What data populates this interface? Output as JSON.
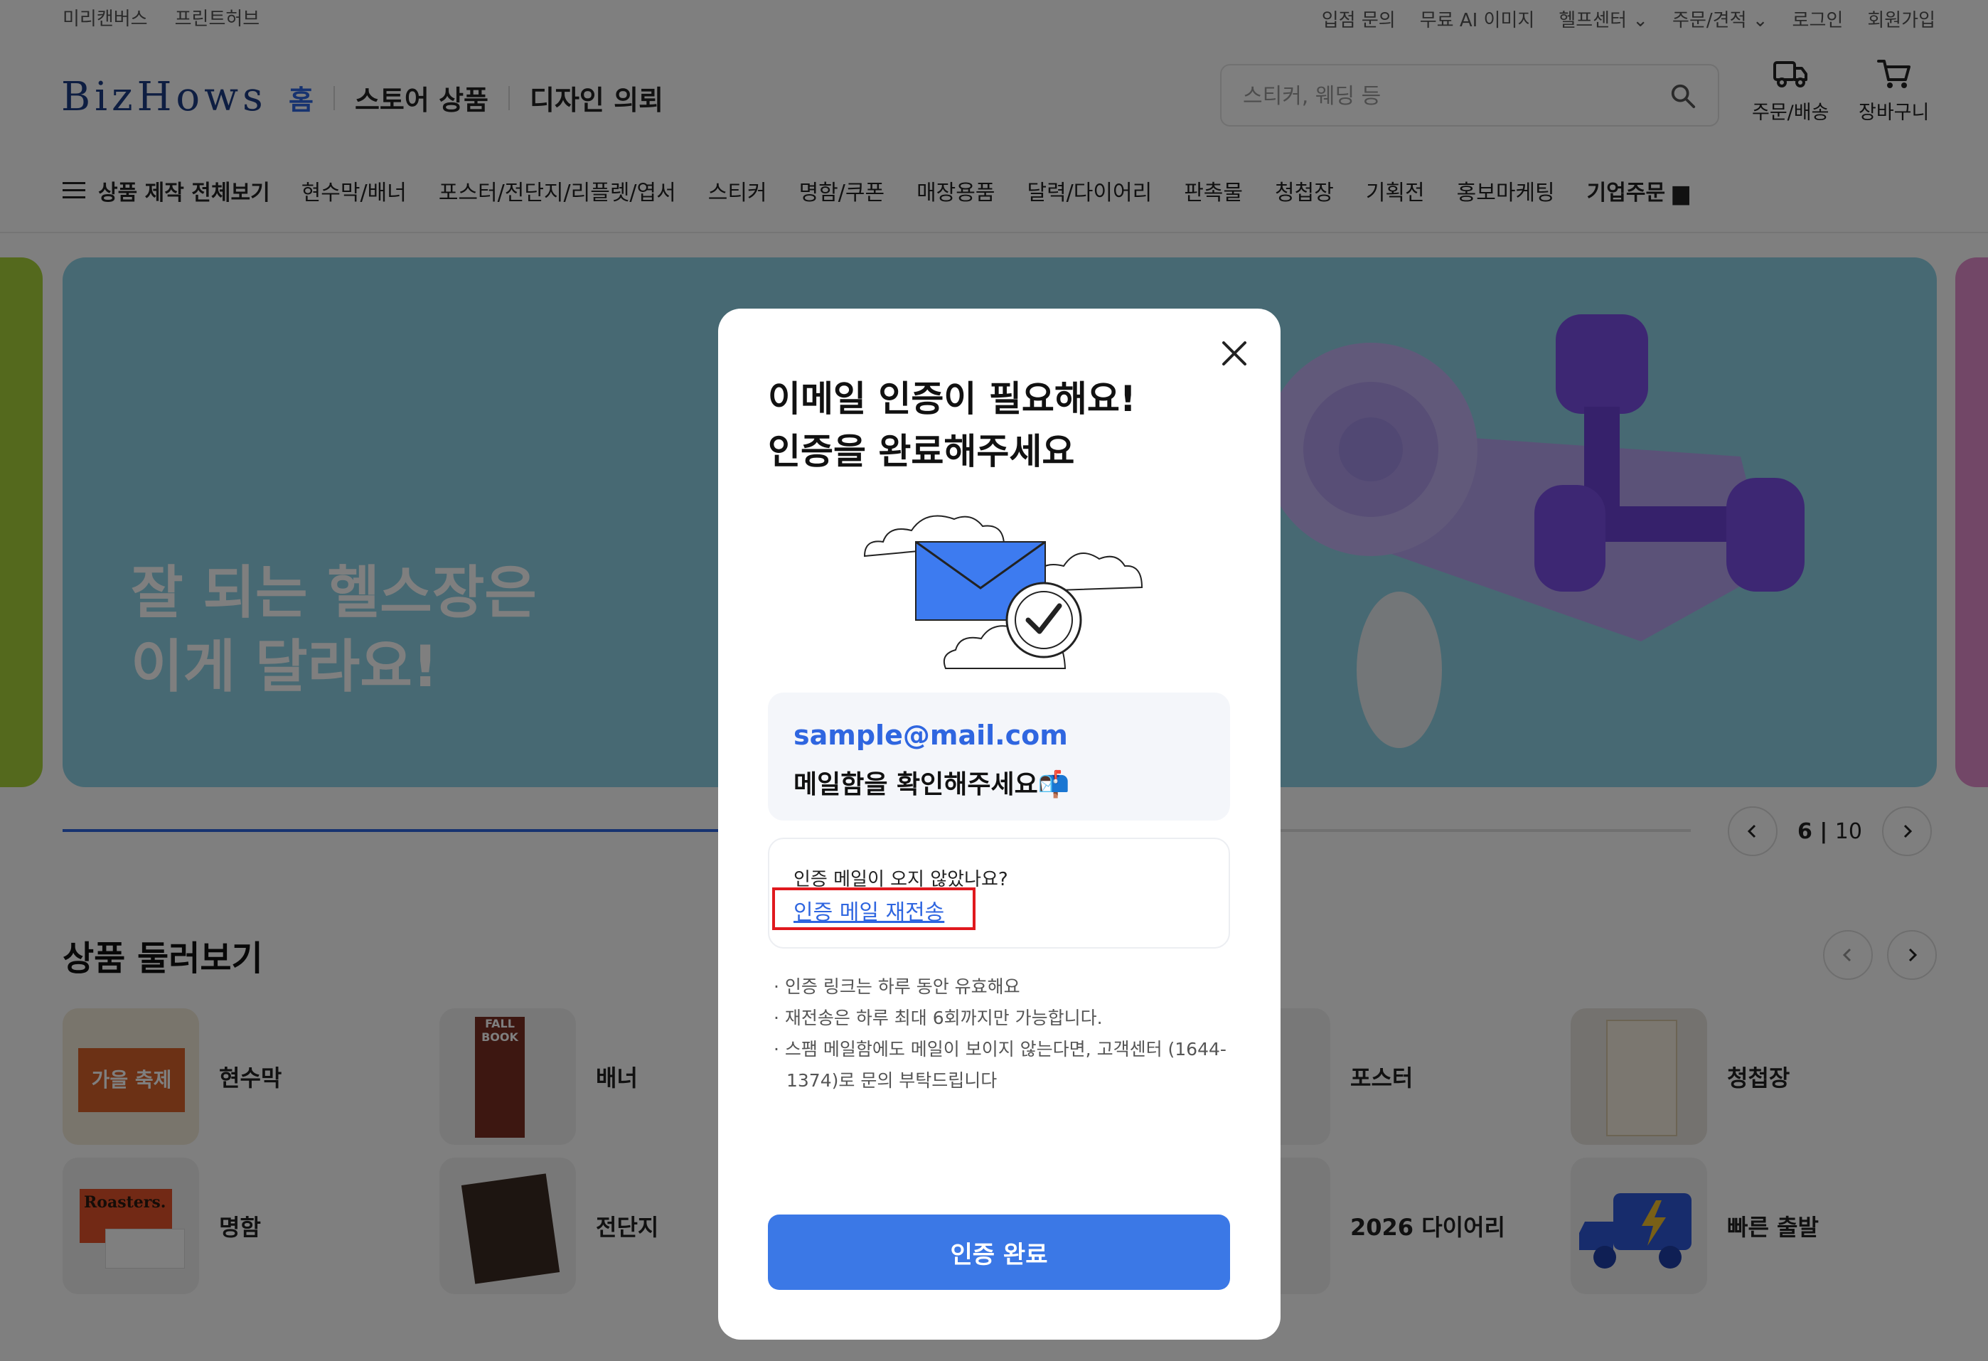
{
  "utility": {
    "left": [
      "미리캔버스",
      "프린트허브"
    ],
    "right": [
      "입점 문의",
      "무료 AI 이미지",
      "헬프센터 ⌄",
      "주문/견적 ⌄",
      "로그인",
      "회원가입"
    ]
  },
  "header": {
    "logo": "BizHows",
    "nav": [
      "홈",
      "스토어 상품",
      "디자인 의뢰"
    ],
    "search_placeholder": "스티커, 웨딩 등",
    "order_label": "주문/배송",
    "cart_label": "장바구니"
  },
  "categories": {
    "all_label": "상품 제작 전체보기",
    "items": [
      "현수막/배너",
      "포스터/전단지/리플렛/엽서",
      "스티커",
      "명함/쿠폰",
      "매장용품",
      "달력/다이어리",
      "판촉물",
      "청첩장",
      "기획전",
      "홍보마케팅"
    ],
    "corporate": "기업주문"
  },
  "banner": {
    "line1": "잘 되는 헬스장은",
    "line2": "이게 달라요!",
    "pager_current": "6",
    "pager_total": "10",
    "progress": 0.6
  },
  "section": {
    "title": "상품 둘러보기",
    "products": [
      {
        "name": "현수막",
        "thumb_text": "가을 축제"
      },
      {
        "name": "배너",
        "thumb_text": "FALL BOOK"
      },
      {
        "name": "포스터",
        "thumb_text": ""
      },
      {
        "name": "청첩장",
        "thumb_text": ""
      },
      {
        "name": "명함",
        "thumb_text": "Roasters."
      },
      {
        "name": "전단지",
        "thumb_text": ""
      },
      {
        "name": "2026 다이어리",
        "thumb_text": ""
      },
      {
        "name": "빠른 출발",
        "thumb_text": ""
      }
    ]
  },
  "modal": {
    "title_line1": "이메일 인증이 필요해요!",
    "title_line2": "인증을 완료해주세요",
    "email": "sample@mail.com",
    "check_inbox": "메일함을 확인해주세요📬",
    "not_received": "인증 메일이 오지 않았나요?",
    "resend_link": "인증 메일 재전송",
    "notes": [
      "· 인증 링크는 하루 동안 유효해요",
      "· 재전송은 하루 최대 6회까지만 가능합니다.",
      "· 스팸 메일함에도 메일이 보이지 않는다면, 고객센터 (1644-1374)로 문의 부탁드립니다"
    ],
    "confirm_button": "인증 완료"
  },
  "colors": {
    "accent": "#3b78e6",
    "highlight": "#e0191e",
    "banner_bg": "#8fd3e6"
  }
}
